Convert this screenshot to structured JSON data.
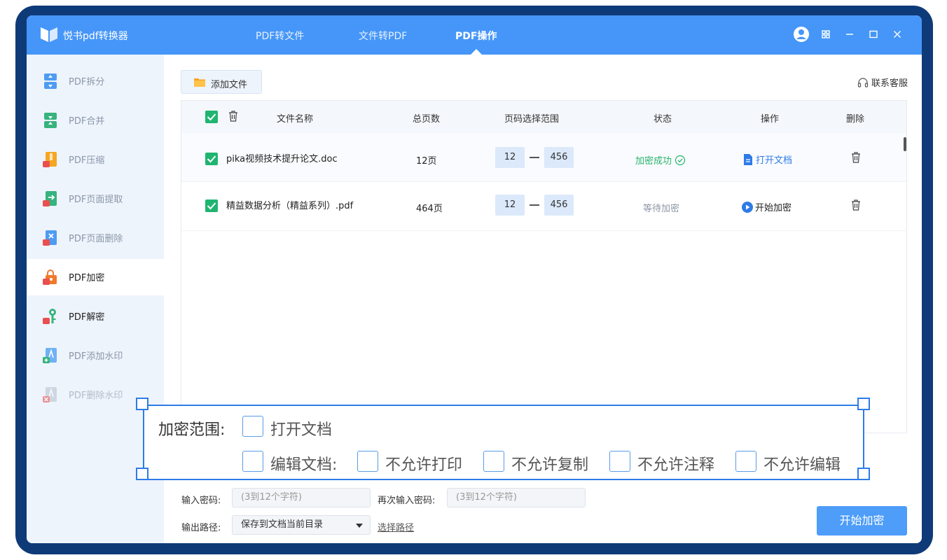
{
  "app": {
    "title": "悦书pdf转换器"
  },
  "nav": {
    "tabs": [
      {
        "label": "PDF转文件"
      },
      {
        "label": "文件转PDF"
      },
      {
        "label": "PDF操作",
        "active": true
      }
    ]
  },
  "sidebar": {
    "items": [
      {
        "label": "PDF拆分",
        "icon": "split-icon"
      },
      {
        "label": "PDF合并",
        "icon": "merge-icon"
      },
      {
        "label": "PDF压缩",
        "icon": "compress-icon"
      },
      {
        "label": "PDF页面提取",
        "icon": "extract-icon"
      },
      {
        "label": "PDF页面删除",
        "icon": "page-delete-icon"
      },
      {
        "label": "PDF加密",
        "icon": "lock-icon",
        "active": true
      },
      {
        "label": "PDF解密",
        "icon": "key-icon"
      },
      {
        "label": "PDF添加水印",
        "icon": "watermark-add-icon"
      },
      {
        "label": "PDF删除水印",
        "icon": "watermark-delete-icon"
      }
    ]
  },
  "toolbar": {
    "add_file": "添加文件",
    "support": "联系客服"
  },
  "table": {
    "headers": {
      "name": "文件名称",
      "pages": "总页数",
      "range": "页码选择范围",
      "status": "状态",
      "action": "操作",
      "delete": "删除"
    },
    "rows": [
      {
        "name": "pika视频技术提升论文.doc",
        "pages": "12页",
        "from": "12",
        "to": "456",
        "status": "加密成功",
        "action": "打开文档"
      },
      {
        "name": "精益数据分析（精益系列）.pdf",
        "pages": "464页",
        "from": "12",
        "to": "456",
        "status": "等待加密",
        "action": "开始加密"
      }
    ]
  },
  "encryption": {
    "title": "加密范围:",
    "open_doc": "打开文档",
    "edit_doc": "编辑文档:",
    "options": [
      "不允许打印",
      "不允许复制",
      "不允许注释",
      "不允许编辑"
    ]
  },
  "form": {
    "password_label": "输入密码:",
    "password_placeholder": "(3到12个字符)",
    "confirm_label": "再次输入密码:",
    "confirm_placeholder": "(3到12个字符)",
    "output_label": "输出路径:",
    "output_value": "保存到文档当前目录",
    "choose_path": "选择路径",
    "start_button": "开始加密"
  },
  "colors": {
    "titlebar": "#4596f8",
    "accent": "#2e7be8",
    "success": "#28b36b",
    "frame": "#0f3a78"
  }
}
